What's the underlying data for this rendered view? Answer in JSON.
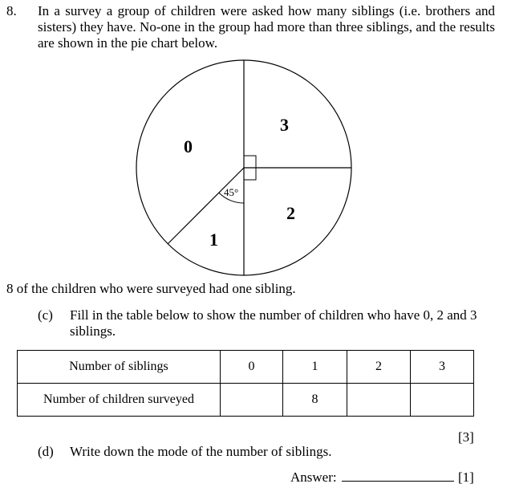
{
  "question": {
    "number": "8.",
    "intro": "In a survey a group of children were asked how many siblings (i.e. brothers and sisters) they have. No-one in the group had more than three siblings, and the results are shown in the pie chart below."
  },
  "chart_data": {
    "type": "pie",
    "title": "",
    "slices": [
      {
        "label": "0",
        "angle_deg": 135,
        "start_deg": 180
      },
      {
        "label": "1",
        "angle_deg": 45,
        "start_deg": 135
      },
      {
        "label": "2",
        "angle_deg": 90,
        "start_deg": 45
      },
      {
        "label": "3",
        "angle_deg": 90,
        "start_deg": -45
      }
    ],
    "annotations": [
      {
        "text": "45°",
        "slice": "1",
        "type": "angle-arc"
      },
      {
        "text": "",
        "slice": "3",
        "type": "right-angle"
      },
      {
        "text": "",
        "slice": "2",
        "type": "right-angle"
      }
    ],
    "labels": {
      "s0": "0",
      "s1": "1",
      "s2": "2",
      "s3": "3",
      "angle": "45°"
    }
  },
  "statement": "8 of the children who were surveyed had one sibling.",
  "part_c": {
    "letter": "(c)",
    "text": "Fill in the table below to show the number of children who have 0, 2 and 3 siblings."
  },
  "table": {
    "row1_header": "Number of siblings",
    "row2_header": "Number of children surveyed",
    "siblings": [
      "0",
      "1",
      "2",
      "3"
    ],
    "children": [
      "",
      "8",
      "",
      ""
    ]
  },
  "marks_c": "[3]",
  "part_d": {
    "letter": "(d)",
    "text": "Write down the mode of the number of siblings."
  },
  "answer_label": "Answer:",
  "answer_value": "",
  "marks_d": "[1]"
}
